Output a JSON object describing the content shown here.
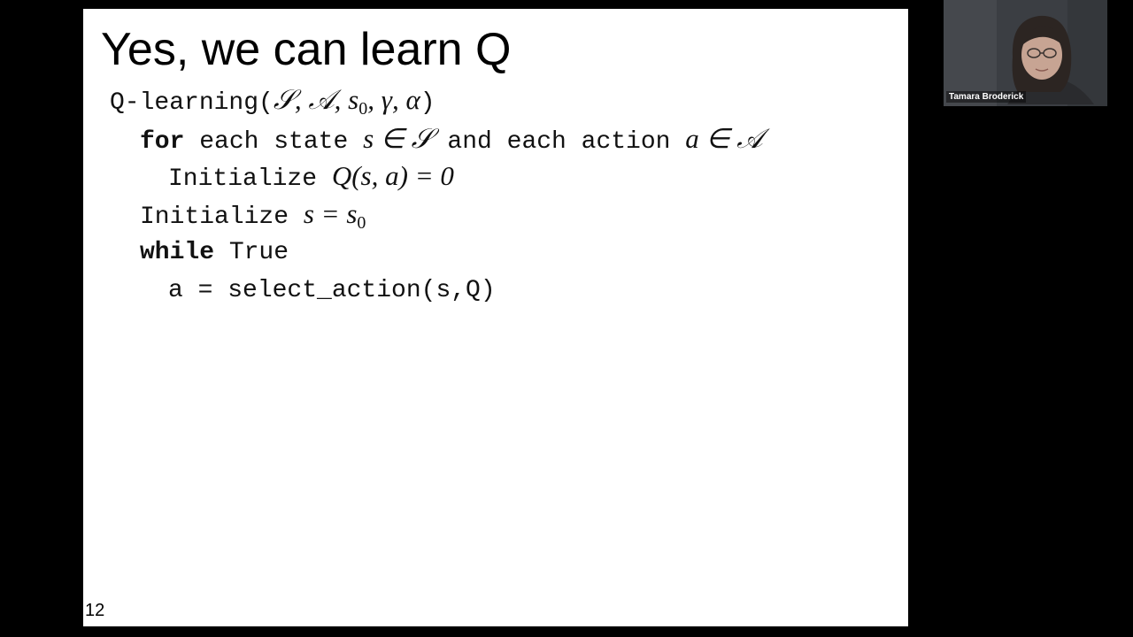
{
  "slide": {
    "title": "Yes, we can learn Q",
    "page_number": "12",
    "code": {
      "line1_func": "Q-learning(",
      "line1_args": "𝒮, 𝒜, s",
      "line1_sub": "0",
      "line1_args_end": ", γ, α",
      "line1_close": ")",
      "line2_kw": "for",
      "line2_text_a": " each state ",
      "line2_math_a": "s ∈ 𝒮",
      "line2_text_b": " and each action ",
      "line2_math_b": "a ∈ 𝒜",
      "line3_text": "Initialize ",
      "line3_math": "Q(s, a) = 0",
      "line4_text": "Initialize ",
      "line4_math": "s = s",
      "line4_sub": "0",
      "line5_kw": "while",
      "line5_text": " True",
      "line6_text": "a = select_action(s,Q)"
    }
  },
  "video": {
    "participant_name": "Tamara Broderick"
  }
}
